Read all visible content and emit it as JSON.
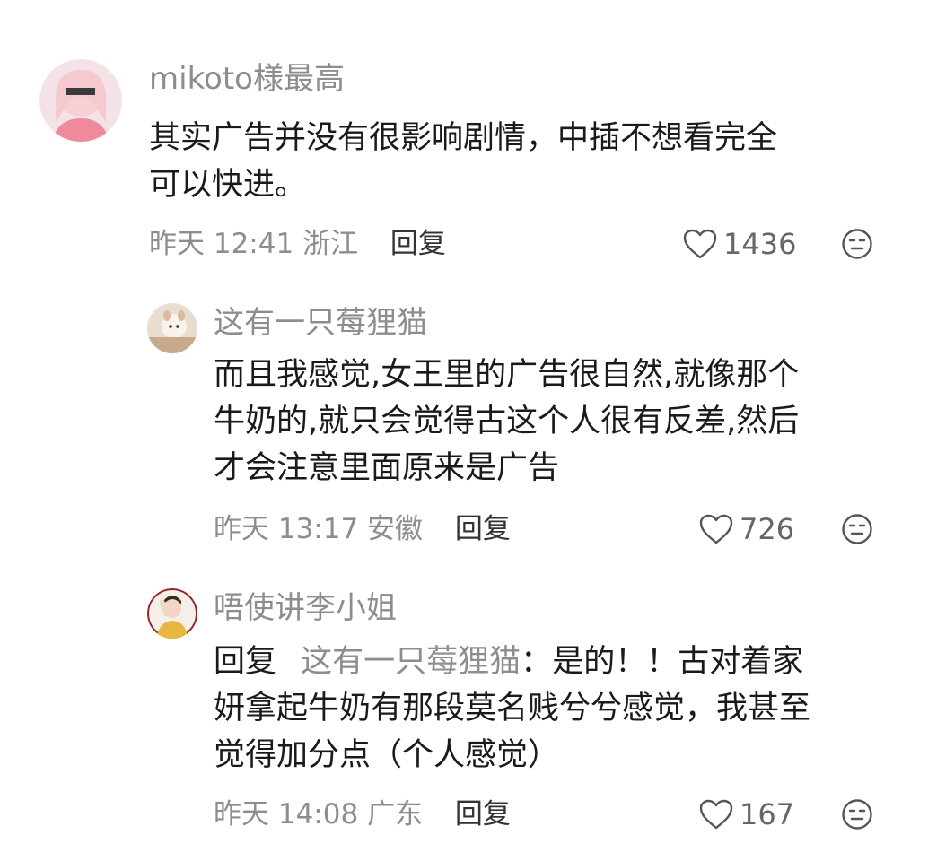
{
  "comments": [
    {
      "username": "mikoto様最高",
      "text_lines": [
        "其实广告并没有很影响剧情，中插不想看完全",
        "可以快进。"
      ],
      "time": "昨天 12:41",
      "location": "浙江",
      "reply_label": "回复",
      "likes": "1436"
    },
    {
      "username": "这有一只莓狸猫",
      "text_lines": [
        "而且我感觉,女王里的广告很自然,就像那个",
        "牛奶的,就只会觉得古这个人很有反差,然后",
        "才会注意里面原来是广告"
      ],
      "time": "昨天 13:17",
      "location": "安徽",
      "reply_label": "回复",
      "likes": "726"
    },
    {
      "username": "唔使讲李小姐",
      "reply_prefix": "回复",
      "reply_target": "这有一只莓狸猫",
      "reply_colon": "：",
      "text_lines": [
        "是的！！古对着家",
        "妍拿起牛奶有那段莫名贱兮兮感觉，我甚至",
        "觉得加分点（个人感觉）"
      ],
      "time": "昨天 14:08",
      "location": "广东",
      "reply_label": "回复",
      "likes": "167"
    }
  ],
  "icons": {
    "like": "heart-outline-icon",
    "dislike": "neutral-face-icon"
  },
  "colors": {
    "text_primary": "#1a1a1a",
    "text_secondary": "#8d8d8d",
    "background": "#ffffff"
  }
}
